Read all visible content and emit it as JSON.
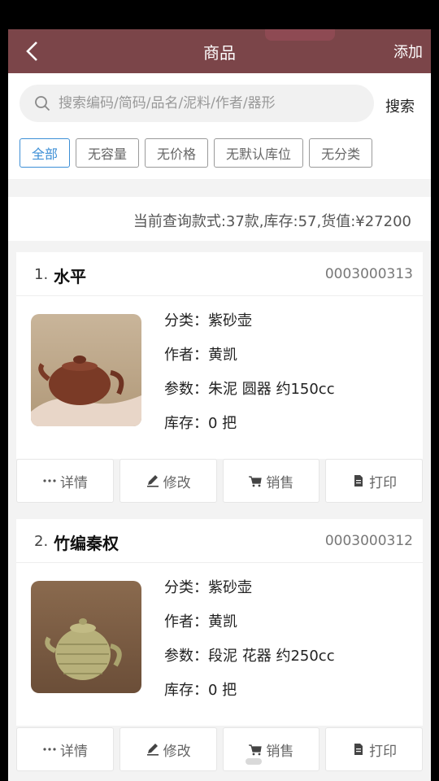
{
  "header": {
    "title": "商品",
    "add_label": "添加"
  },
  "search": {
    "placeholder": "搜索编码/简码/品名/泥料/作者/器形",
    "button_label": "搜索"
  },
  "filters": [
    {
      "label": "全部",
      "active": true
    },
    {
      "label": "无容量",
      "active": false
    },
    {
      "label": "无价格",
      "active": false
    },
    {
      "label": "无默认库位",
      "active": false
    },
    {
      "label": "无分类",
      "active": false
    }
  ],
  "summary": "当前查询款式:37款,库存:57,货值:¥27200",
  "products": [
    {
      "index": "1.",
      "name": "水平",
      "code": "0003000313",
      "category": "分类：紫砂壶",
      "author": "作者：黄凯",
      "params": "参数：朱泥  圆器  约150cc",
      "stock": "库存：0 把"
    },
    {
      "index": "2.",
      "name": "竹编秦权",
      "code": "0003000312",
      "category": "分类：紫砂壶",
      "author": "作者：黄凯",
      "params": "参数：段泥  花器  约250cc",
      "stock": "库存：0 把"
    }
  ],
  "actions": {
    "detail": "详情",
    "edit": "修改",
    "sell": "销售",
    "print": "打印"
  },
  "icons": [
    "back-arrow-icon",
    "search-icon",
    "more-dots-icon",
    "pencil-icon",
    "cart-icon",
    "document-icon"
  ],
  "colors": {
    "header_bg": "#7b4549",
    "active_chip": "#3d8fd6"
  }
}
